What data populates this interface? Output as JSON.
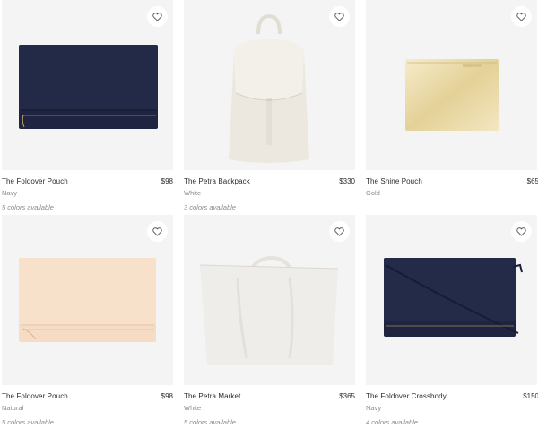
{
  "colors": {
    "photo_bg": "#f4f4f4",
    "navy": "#1f2540",
    "cream": "#ece8df",
    "gold": "#e9dbb0",
    "peach": "#f6dcc4",
    "white_bag": "#eeece8"
  },
  "products": [
    {
      "name": "The Foldover Pouch",
      "price": "$98",
      "color": "Navy",
      "availability": "5 colors available",
      "icon": "heart-icon"
    },
    {
      "name": "The Petra Backpack",
      "price": "$330",
      "color": "White",
      "availability": "3 colors available",
      "icon": "heart-icon"
    },
    {
      "name": "The Shine Pouch",
      "price": "$65",
      "color": "Gold",
      "availability": "",
      "icon": "heart-icon"
    },
    {
      "name": "The Foldover Pouch",
      "price": "$98",
      "color": "Natural",
      "availability": "5 colors available",
      "icon": "heart-icon"
    },
    {
      "name": "The Petra Market",
      "price": "$365",
      "color": "White",
      "availability": "5 colors available",
      "icon": "heart-icon"
    },
    {
      "name": "The Foldover Crossbody",
      "price": "$150",
      "color": "Navy",
      "availability": "4 colors available",
      "icon": "heart-icon"
    }
  ]
}
